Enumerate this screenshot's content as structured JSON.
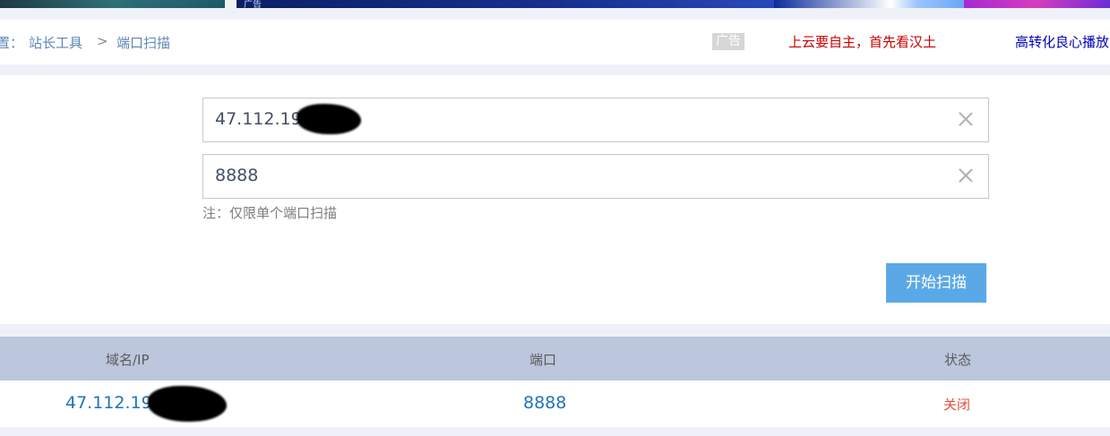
{
  "banner": {
    "ad_tag": "广告"
  },
  "breadcrumb": {
    "prefix": "置：",
    "items": [
      "站长工具",
      "端口扫描"
    ],
    "separator": ">"
  },
  "ads": {
    "badge": "广告",
    "red_link": "上云要自主，首先看汉土",
    "blue_link": "高转化良心播放"
  },
  "form": {
    "host_value": "47.112.19",
    "port_value": "8888",
    "note": "注：仅限单个端口扫描",
    "scan_button": "开始扫描"
  },
  "table": {
    "headers": [
      "域名/IP",
      "端口",
      "状态"
    ],
    "rows": [
      {
        "domain": "47.112.19",
        "port": "8888",
        "status": "关闭"
      }
    ]
  },
  "colors": {
    "accent_button": "#5aa9e6",
    "link_blue": "#1e73be",
    "status_closed": "#e0503c",
    "table_header_bg": "#bcc6dc"
  }
}
